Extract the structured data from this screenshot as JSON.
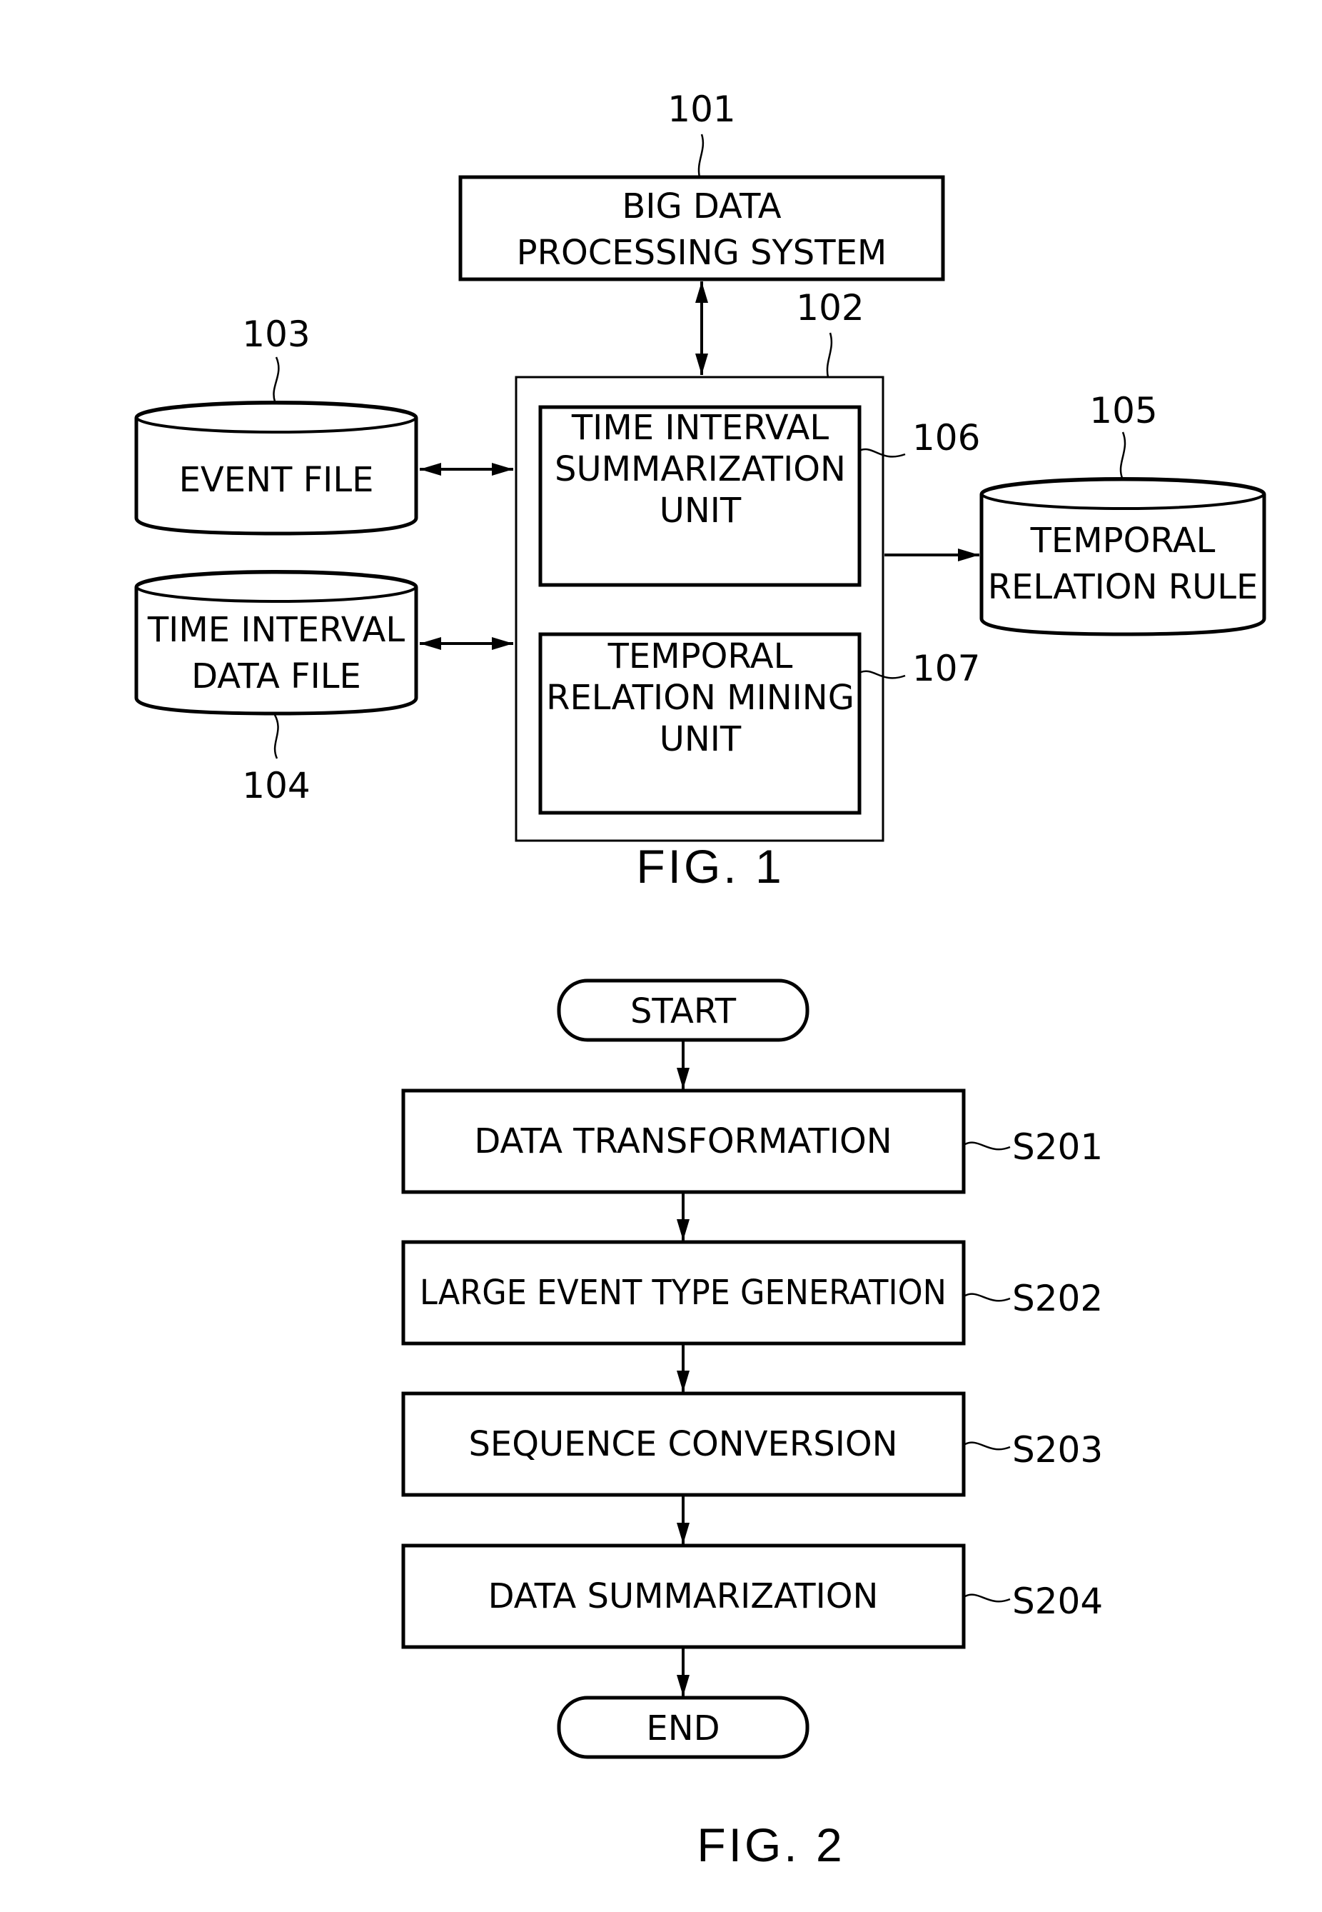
{
  "figure1": {
    "caption": "FIG. 1",
    "big_data_system": {
      "ref": "101",
      "lines": [
        "BIG DATA",
        "PROCESSING SYSTEM"
      ]
    },
    "processing_unit": {
      "ref": "102"
    },
    "event_file": {
      "ref": "103",
      "lines": [
        "EVENT FILE"
      ]
    },
    "time_interval_data_file": {
      "ref": "104",
      "lines": [
        "TIME INTERVAL",
        "DATA FILE"
      ]
    },
    "temporal_relation_rule": {
      "ref": "105",
      "lines": [
        "TEMPORAL",
        "RELATION RULE"
      ]
    },
    "summarization_unit": {
      "ref": "106",
      "lines": [
        "TIME INTERVAL",
        "SUMMARIZATION",
        "UNIT"
      ]
    },
    "mining_unit": {
      "ref": "107",
      "lines": [
        "TEMPORAL",
        "RELATION MINING",
        "UNIT"
      ]
    }
  },
  "figure2": {
    "caption": "FIG. 2",
    "start": "START",
    "end": "END",
    "steps": [
      {
        "label": "DATA TRANSFORMATION",
        "ref": "S201"
      },
      {
        "label": "LARGE EVENT TYPE GENERATION",
        "ref": "S202"
      },
      {
        "label": "SEQUENCE CONVERSION",
        "ref": "S203"
      },
      {
        "label": "DATA SUMMARIZATION",
        "ref": "S204"
      }
    ]
  }
}
